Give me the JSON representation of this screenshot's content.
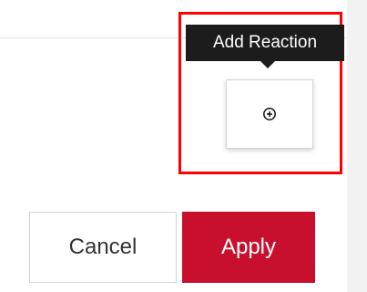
{
  "tooltip": {
    "label": "Add Reaction"
  },
  "reaction_control": {
    "icon": "add-reaction-icon"
  },
  "actions": {
    "cancel_label": "Cancel",
    "apply_label": "Apply"
  },
  "colors": {
    "highlight": "#ff0000",
    "tooltip_bg": "#1c1c1c",
    "apply_bg": "#c8102e",
    "panel_bg": "#ffffff"
  }
}
